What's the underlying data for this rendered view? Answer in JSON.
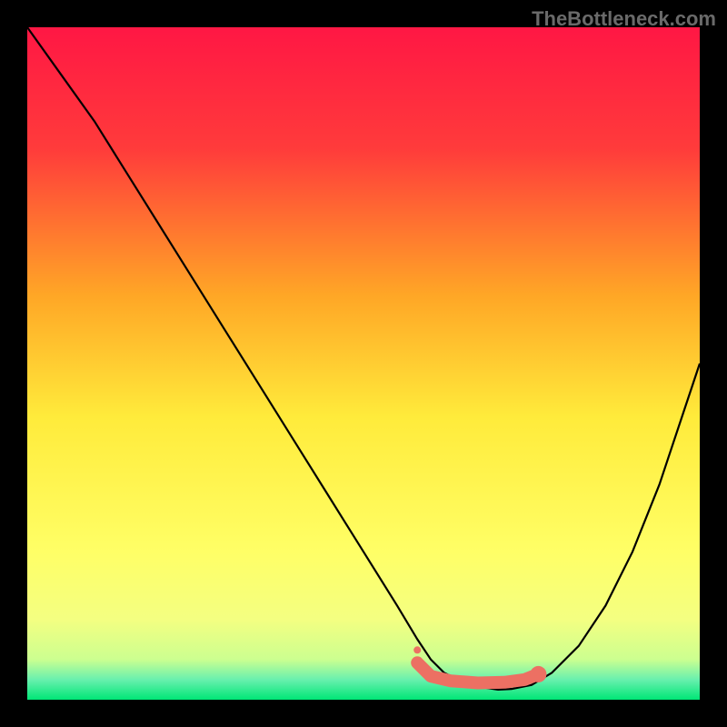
{
  "watermark": "TheBottleneck.com",
  "chart_data": {
    "type": "line",
    "title": "",
    "xlabel": "",
    "ylabel": "",
    "xlim": [
      0,
      100
    ],
    "ylim": [
      0,
      100
    ],
    "gradient_stops": [
      {
        "offset": 0,
        "color": "#ff1744"
      },
      {
        "offset": 18,
        "color": "#ff3b3b"
      },
      {
        "offset": 40,
        "color": "#ffa726"
      },
      {
        "offset": 58,
        "color": "#ffeb3b"
      },
      {
        "offset": 78,
        "color": "#ffff66"
      },
      {
        "offset": 88,
        "color": "#f4ff81"
      },
      {
        "offset": 94,
        "color": "#ccff90"
      },
      {
        "offset": 97,
        "color": "#69f0ae"
      },
      {
        "offset": 100,
        "color": "#00e676"
      }
    ],
    "series": [
      {
        "name": "bottleneck-curve",
        "x": [
          0,
          5,
          10,
          15,
          20,
          25,
          30,
          35,
          40,
          45,
          50,
          55,
          58,
          60,
          62,
          65,
          68,
          70,
          72,
          75,
          78,
          82,
          86,
          90,
          94,
          98,
          100
        ],
        "values": [
          100,
          93,
          86,
          78,
          70,
          62,
          54,
          46,
          38,
          30,
          22,
          14,
          9,
          6,
          4,
          2.5,
          1.8,
          1.5,
          1.6,
          2.2,
          4,
          8,
          14,
          22,
          32,
          44,
          50
        ]
      }
    ],
    "highlight_region": {
      "name": "optimal-range",
      "points": [
        {
          "x": 58,
          "y": 5.5
        },
        {
          "x": 60,
          "y": 3.5
        },
        {
          "x": 63,
          "y": 2.8
        },
        {
          "x": 67,
          "y": 2.5
        },
        {
          "x": 71,
          "y": 2.6
        },
        {
          "x": 74,
          "y": 3.0
        },
        {
          "x": 76,
          "y": 3.8
        }
      ],
      "color": "#ec7063",
      "dot_radius_start": 4,
      "dot_radius_end": 9
    }
  }
}
